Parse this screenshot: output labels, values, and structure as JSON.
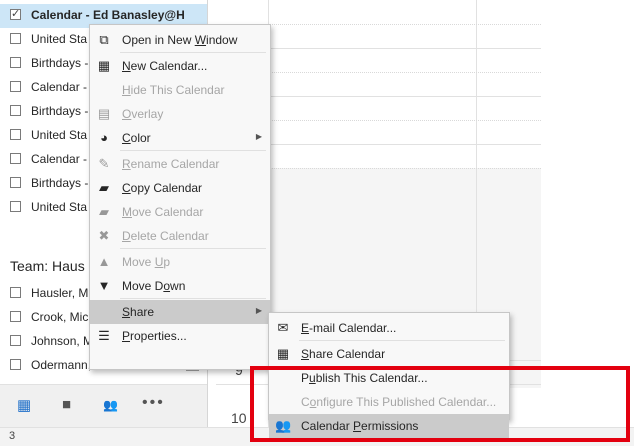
{
  "calendars": [
    {
      "label": "Calendar - Ed Banasley@H",
      "checked": true,
      "selected": true
    },
    {
      "label": "United Sta",
      "checked": false
    },
    {
      "label": "Birthdays -",
      "checked": false
    },
    {
      "label": "Calendar -",
      "checked": false
    },
    {
      "label": "Birthdays -",
      "checked": false
    },
    {
      "label": "United Sta",
      "checked": false
    },
    {
      "label": "Calendar -",
      "checked": false
    },
    {
      "label": "Birthdays -",
      "checked": false
    },
    {
      "label": "United Sta",
      "checked": false
    }
  ],
  "team_group": {
    "header": "Team: Haus",
    "members": [
      {
        "label": "Hausler, M"
      },
      {
        "label": "Crook, Mic"
      },
      {
        "label": "Johnson, M"
      },
      {
        "label": "Odermann, Rick"
      }
    ]
  },
  "nav_bar": {
    "calendar_icon": "▦",
    "tasks_icon": "■",
    "people_icon": "👥",
    "more_icon": "•••"
  },
  "status_bar": {
    "text": "3"
  },
  "calendar_grid": {
    "hours": [
      "9",
      "10"
    ]
  },
  "context_menu": {
    "items": [
      {
        "pre": "Open in New ",
        "ul": "W",
        "post": "indow",
        "icon": "⧉",
        "disabled": false
      },
      {
        "pre": "",
        "ul": "N",
        "post": "ew Calendar...",
        "icon": "▦",
        "disabled": false
      },
      {
        "pre": "",
        "ul": "H",
        "post": "ide This Calendar",
        "icon": "",
        "disabled": true
      },
      {
        "pre": "",
        "ul": "O",
        "post": "verlay",
        "icon": "▤",
        "disabled": true
      },
      {
        "pre": "",
        "ul": "C",
        "post": "olor",
        "icon": "◕",
        "disabled": false,
        "submenu": true
      },
      {
        "pre": "",
        "ul": "R",
        "post": "ename Calendar",
        "icon": "✎",
        "disabled": true
      },
      {
        "pre": "",
        "ul": "C",
        "post": "opy Calendar",
        "icon": "▰",
        "disabled": false
      },
      {
        "pre": "",
        "ul": "M",
        "post": "ove Calendar",
        "icon": "▰",
        "disabled": true
      },
      {
        "pre": "",
        "ul": "D",
        "post": "elete Calendar",
        "icon": "✖",
        "disabled": true
      },
      {
        "pre": "Move ",
        "ul": "U",
        "post": "p",
        "icon": "▲",
        "disabled": true
      },
      {
        "pre": "Move D",
        "ul": "o",
        "post": "wn",
        "icon": "▼",
        "disabled": false
      },
      {
        "pre": "",
        "ul": "S",
        "post": "hare",
        "icon": "",
        "disabled": false,
        "submenu": true,
        "highlighted": true
      },
      {
        "pre": "",
        "ul": "P",
        "post": "roperties...",
        "icon": "☰",
        "disabled": false
      }
    ]
  },
  "share_menu": {
    "items": [
      {
        "pre": "",
        "ul": "E",
        "post": "-mail Calendar...",
        "icon": "✉",
        "disabled": false
      },
      {
        "pre": "",
        "ul": "S",
        "post": "hare Calendar",
        "icon": "▦",
        "disabled": false
      },
      {
        "pre": "P",
        "ul": "u",
        "post": "blish This Calendar...",
        "icon": "",
        "disabled": false
      },
      {
        "pre": "C",
        "ul": "o",
        "post": "nfigure This Published Calendar...",
        "icon": "",
        "disabled": true
      },
      {
        "pre": "Calendar ",
        "ul": "P",
        "post": "ermissions",
        "icon": "👥",
        "disabled": false,
        "highlighted": true
      }
    ]
  },
  "colors": {
    "selection": "#cde6f7",
    "menu_highlight": "#cbcbcb",
    "annotation_box": "#e3000f"
  }
}
